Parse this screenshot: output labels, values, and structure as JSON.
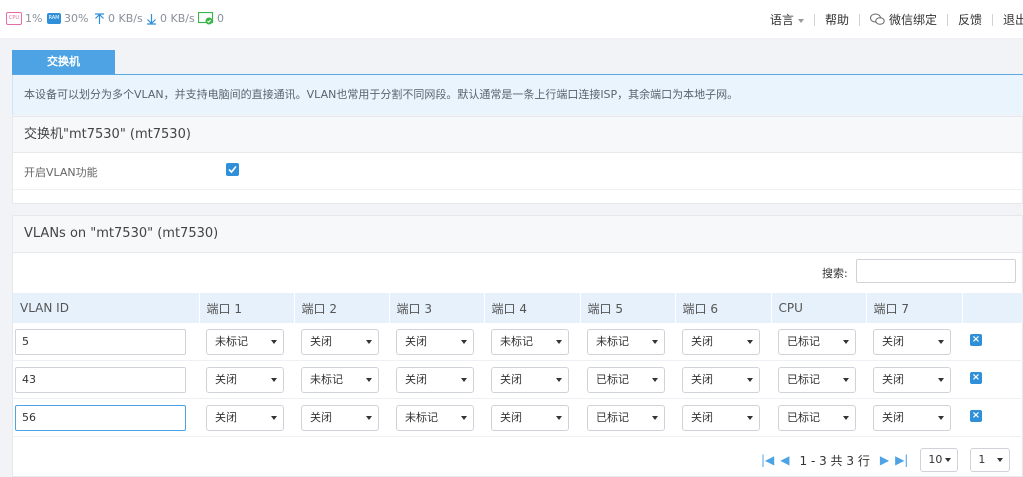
{
  "topbar": {
    "cpu": {
      "icon": "cpu-icon",
      "icon_text": "CPU",
      "value": "1%"
    },
    "ram": {
      "icon": "ram-icon",
      "icon_text": "RAM",
      "value": "30%"
    },
    "upload": {
      "icon": "upload-arrow-icon",
      "value": "0 KB/s"
    },
    "download": {
      "icon": "download-arrow-icon",
      "value": "0 KB/s"
    },
    "clients": {
      "icon": "monitor-icon",
      "value": "0"
    },
    "nav": {
      "language": "语言",
      "help": "帮助",
      "wechat": "微信绑定",
      "feedback": "反馈",
      "logout": "退出"
    }
  },
  "tab": {
    "label": "交换机"
  },
  "description": "本设备可以划分为多个VLAN，并支持电脑间的直接通讯。VLAN也常用于分割不同网段。默认通常是一条上行端口连接ISP，其余端口为本地子网。",
  "switch_section": {
    "title": "交换机\"mt7530\" (mt7530)",
    "enable_vlan_label": "开启VLAN功能",
    "enable_vlan_checked": true
  },
  "vlan_section": {
    "title": "VLANs on \"mt7530\" (mt7530)",
    "search_label": "搜索:",
    "search_value": "",
    "columns": [
      "VLAN ID",
      "端口 1",
      "端口 2",
      "端口 3",
      "端口 4",
      "端口 5",
      "端口 6",
      "CPU",
      "端口 7"
    ],
    "rows": [
      {
        "vlan_id": "5",
        "ports": [
          "未标记",
          "关闭",
          "关闭",
          "未标记",
          "未标记",
          "关闭",
          "已标记",
          "关闭"
        ]
      },
      {
        "vlan_id": "43",
        "ports": [
          "关闭",
          "未标记",
          "关闭",
          "关闭",
          "已标记",
          "关闭",
          "已标记",
          "关闭"
        ]
      },
      {
        "vlan_id": "56",
        "ports": [
          "关闭",
          "关闭",
          "未标记",
          "关闭",
          "已标记",
          "关闭",
          "已标记",
          "关闭"
        ]
      }
    ]
  },
  "pagination": {
    "info": "1 - 3 共 3 行",
    "page_size": "10",
    "page": "1"
  },
  "colors": {
    "accent": "#4da3e3",
    "checkbox": "#2f8fd8",
    "cpu": "#e46fa6",
    "clients": "#3cb54a"
  }
}
